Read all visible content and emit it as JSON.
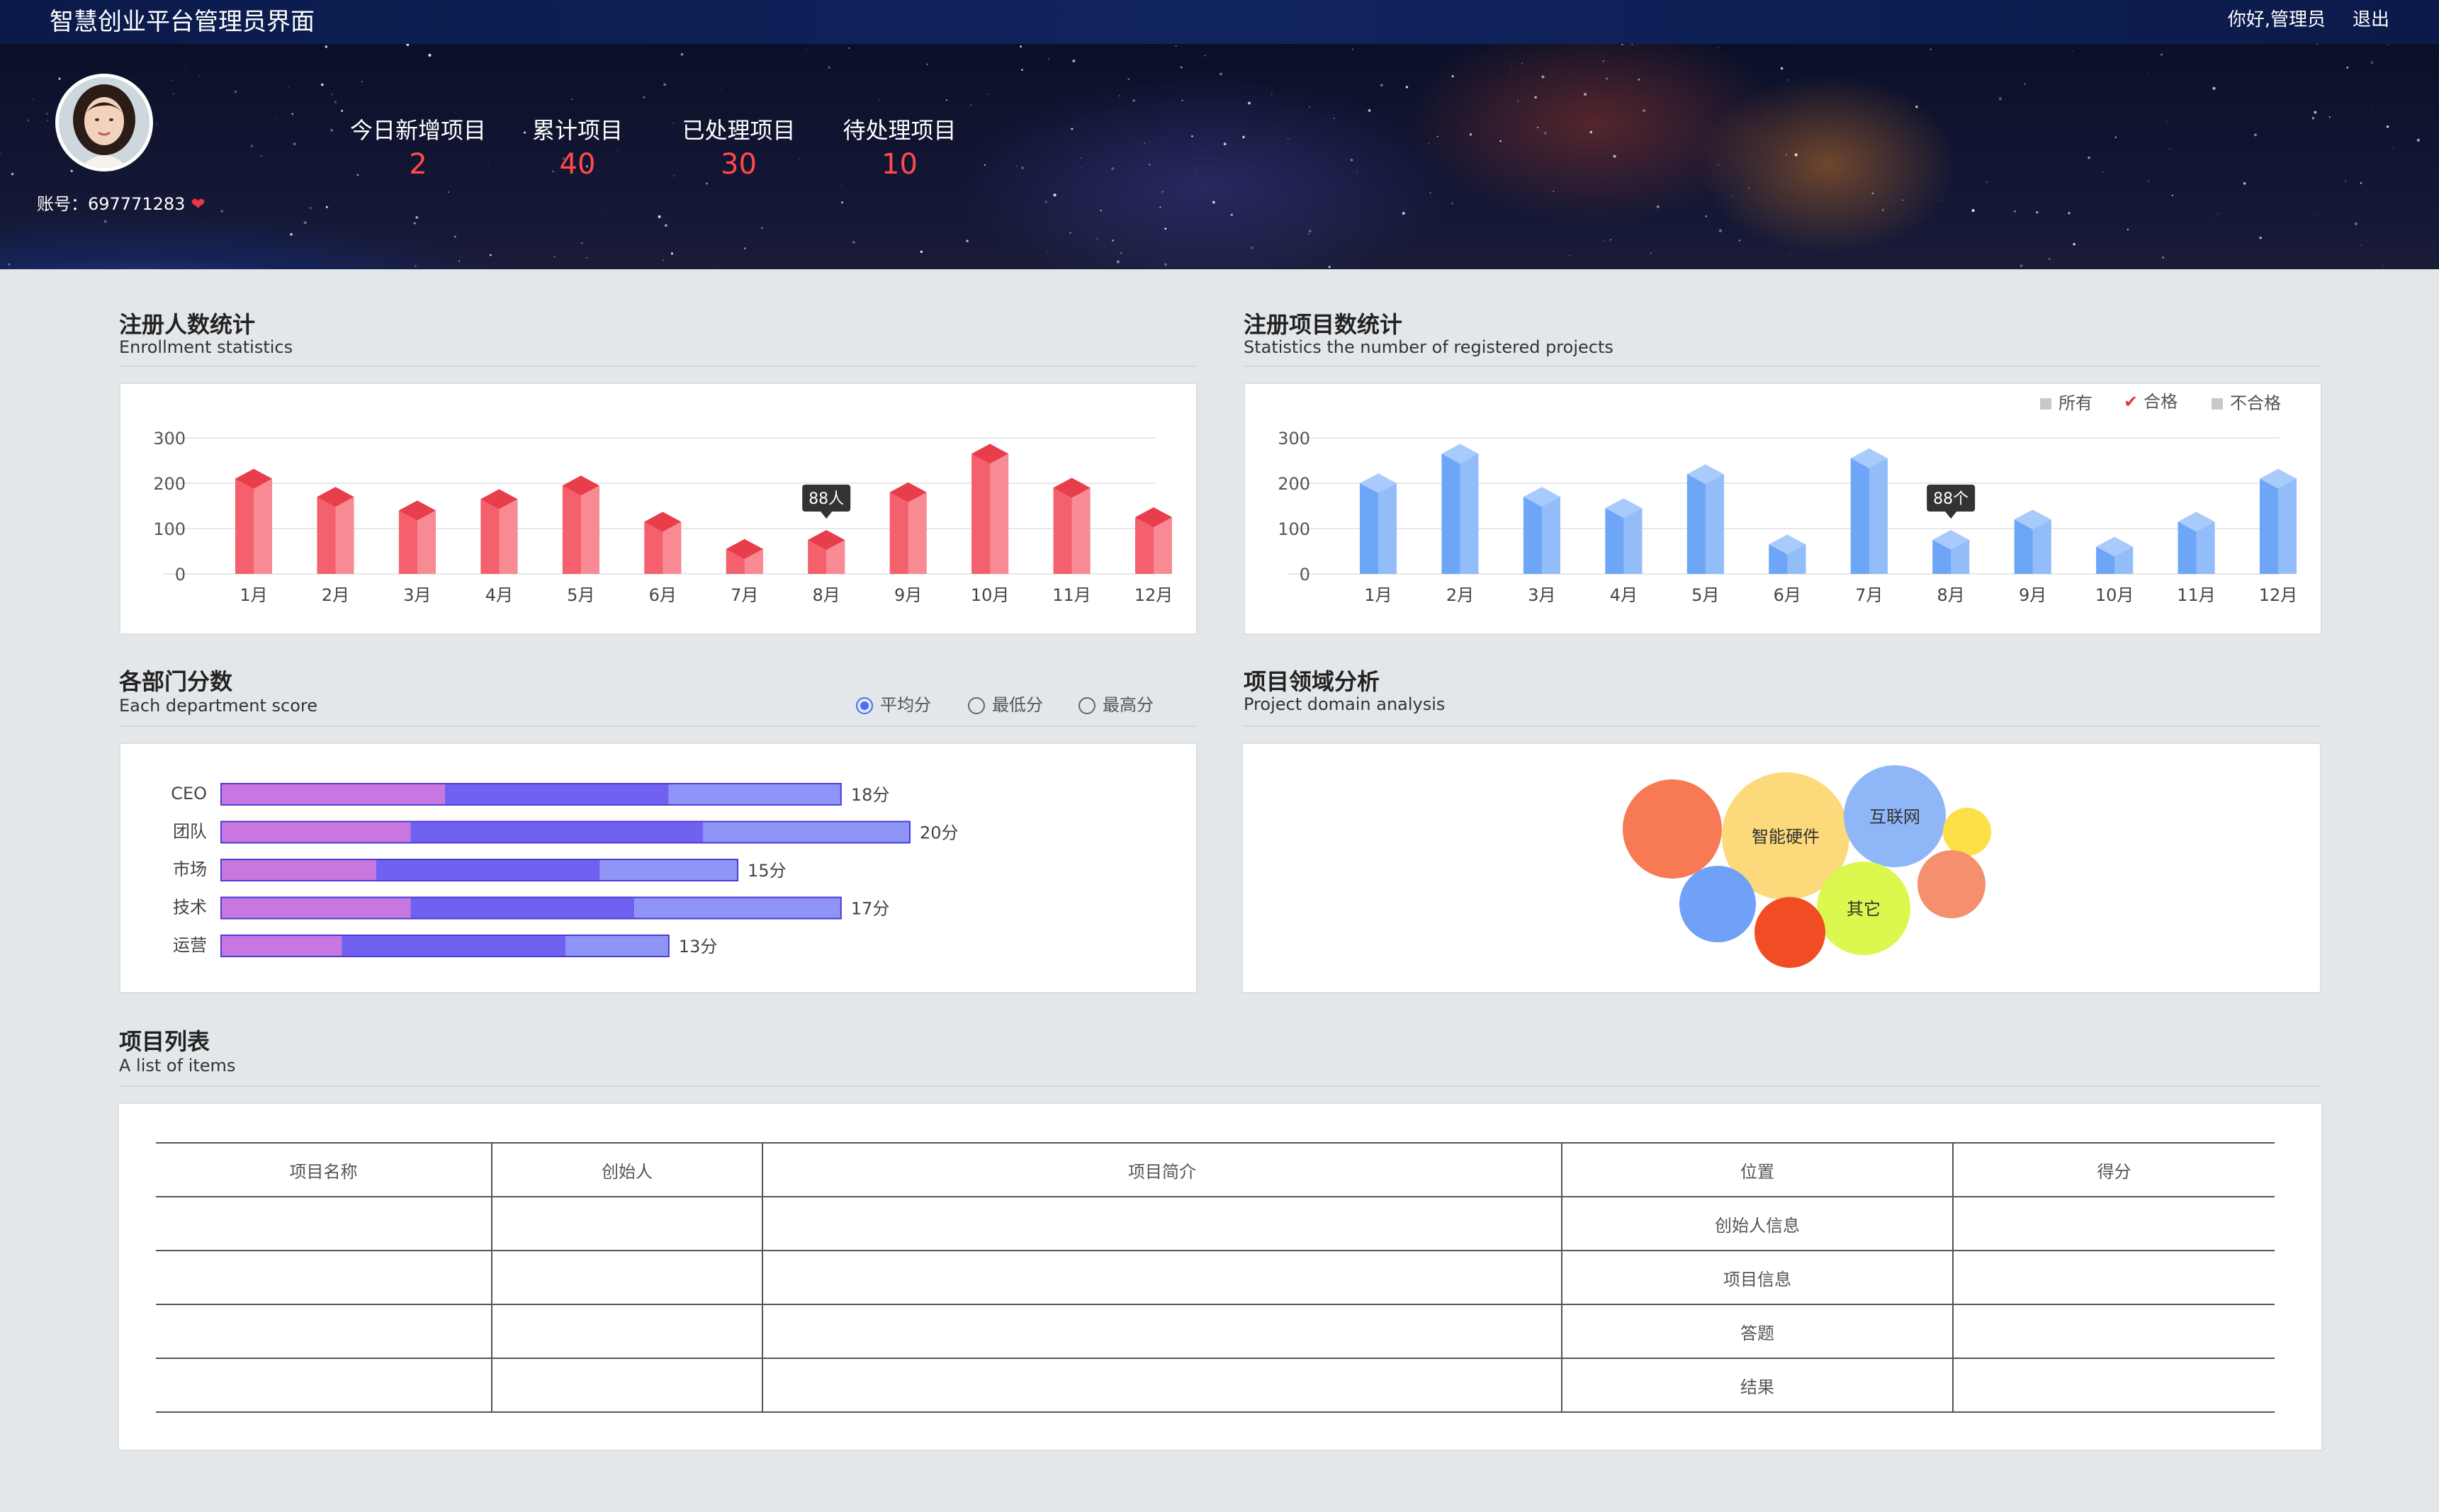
{
  "header": {
    "app_title": "智慧创业平台管理员界面",
    "greeting": "你好,管理员",
    "logout": "退出"
  },
  "profile": {
    "account": "账号：697771283"
  },
  "stats": [
    {
      "label": "今日新增项目",
      "value": "2"
    },
    {
      "label": "累计项目",
      "value": "40"
    },
    {
      "label": "已处理项目",
      "value": "30"
    },
    {
      "label": "待处理项目",
      "value": "10"
    }
  ],
  "sections": {
    "enrollment": {
      "title": "注册人数统计",
      "subtitle": "Enrollment statistics"
    },
    "projects": {
      "title": "注册项目数统计",
      "subtitle": "Statistics the number of registered projects"
    },
    "department": {
      "title": "各部门分数",
      "subtitle": "Each department score"
    },
    "domain": {
      "title": "项目领域分析",
      "subtitle": "Project domain analysis"
    },
    "list": {
      "title": "项目列表",
      "subtitle": "A list of items"
    }
  },
  "projects_legend": {
    "items": [
      {
        "label": "所有",
        "checked": false
      },
      {
        "label": "合格",
        "checked": true
      },
      {
        "label": "不合格",
        "checked": false
      }
    ]
  },
  "department_options": {
    "selected": "平均分",
    "options": [
      "平均分",
      "最低分",
      "最高分"
    ]
  },
  "colors": {
    "red_front": "#f4606c",
    "red_top": "#e83d4b",
    "blue_front": "#6ea6f7",
    "blue_top": "#a9cbfb",
    "bar_seg1": "#c977e0",
    "bar_seg2": "#7061f0",
    "bar_seg3": "#8f95f7"
  },
  "chart_data": [
    {
      "type": "bar",
      "categories": [
        "1月",
        "2月",
        "3月",
        "4月",
        "5月",
        "6月",
        "7月",
        "8月",
        "9月",
        "10月",
        "11月",
        "12月"
      ],
      "values": [
        210,
        170,
        140,
        165,
        195,
        115,
        55,
        75,
        180,
        265,
        190,
        125
      ],
      "ylim": [
        0,
        300
      ],
      "yticks": [
        "0",
        "100",
        "200",
        "300"
      ],
      "tooltip": {
        "category": "8月",
        "text": "88人"
      },
      "grid": true
    },
    {
      "type": "bar",
      "categories": [
        "1月",
        "2月",
        "3月",
        "4月",
        "5月",
        "6月",
        "7月",
        "8月",
        "9月",
        "10月",
        "11月",
        "12月"
      ],
      "values": [
        200,
        265,
        170,
        145,
        220,
        65,
        255,
        75,
        120,
        60,
        115,
        210
      ],
      "ylim": [
        0,
        300
      ],
      "yticks": [
        "0",
        "100",
        "200",
        "300"
      ],
      "tooltip": {
        "category": "8月",
        "text": "88个"
      },
      "grid": true
    },
    {
      "type": "bar",
      "orientation": "horizontal-stacked",
      "categories": [
        "CEO",
        "团队",
        "市场",
        "技术",
        "运营"
      ],
      "series": [
        {
          "values": [
            6.5,
            5.5,
            4.5,
            5.5,
            3.5
          ]
        },
        {
          "values": [
            6.5,
            8.5,
            6.5,
            6.5,
            6.5
          ]
        },
        {
          "values": [
            5,
            6,
            4,
            6,
            3
          ]
        }
      ],
      "totals": [
        18,
        20,
        15,
        17,
        13
      ],
      "total_labels": [
        "18分",
        "20分",
        "15分",
        "17分",
        "13分"
      ]
    }
  ],
  "domain_bubbles": [
    {
      "label": "",
      "color": "#f77a55"
    },
    {
      "label": "智能硬件",
      "color": "#fcd97b"
    },
    {
      "label": "互联网",
      "color": "#8fb7f7"
    },
    {
      "label": "",
      "color": "#fde047"
    },
    {
      "label": "",
      "color": "#f4906e"
    },
    {
      "label": "其它",
      "color": "#dcf74d"
    },
    {
      "label": "",
      "color": "#6ea1f7"
    },
    {
      "label": "",
      "color": "#f14d24"
    }
  ],
  "table": {
    "columns": [
      "项目名称",
      "创始人",
      "项目简介",
      "位置",
      "得分"
    ],
    "rows": [
      [
        "",
        "",
        "",
        "创始人信息",
        ""
      ],
      [
        "",
        "",
        "",
        "项目信息",
        ""
      ],
      [
        "",
        "",
        "",
        "答题",
        ""
      ],
      [
        "",
        "",
        "",
        "结果",
        ""
      ]
    ]
  }
}
